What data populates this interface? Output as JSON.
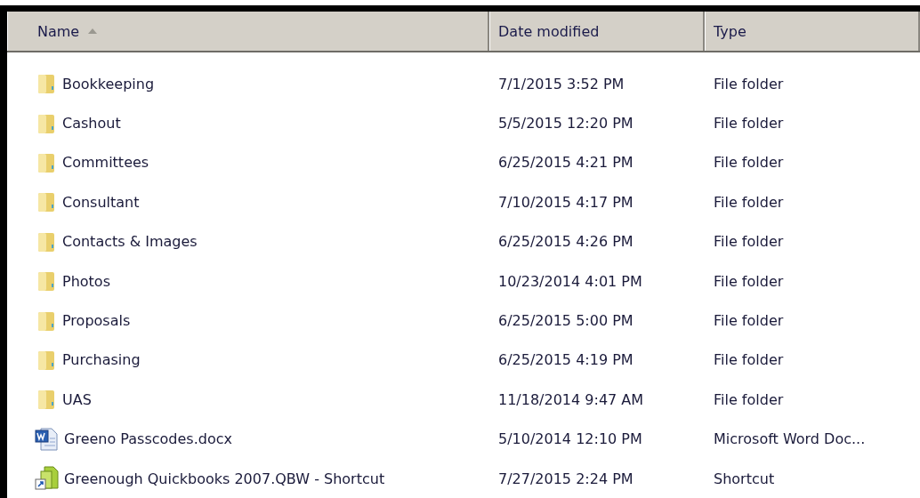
{
  "columns": [
    {
      "label": "Name",
      "sorted": true
    },
    {
      "label": "Date modified",
      "sorted": false
    },
    {
      "label": "Type",
      "sorted": false
    }
  ],
  "rows": [
    {
      "kind": "folder",
      "name": "Bookkeeping",
      "date": "7/1/2015 3:52 PM",
      "type": "File folder"
    },
    {
      "kind": "folder",
      "name": "Cashout",
      "date": "5/5/2015 12:20 PM",
      "type": "File folder"
    },
    {
      "kind": "folder",
      "name": "Committees",
      "date": "6/25/2015 4:21 PM",
      "type": "File folder"
    },
    {
      "kind": "folder",
      "name": "Consultant",
      "date": "7/10/2015 4:17 PM",
      "type": "File folder"
    },
    {
      "kind": "folder",
      "name": "Contacts & Images",
      "date": "6/25/2015 4:26 PM",
      "type": "File folder"
    },
    {
      "kind": "folder",
      "name": "Photos",
      "date": "10/23/2014 4:01 PM",
      "type": "File folder"
    },
    {
      "kind": "folder",
      "name": "Proposals",
      "date": "6/25/2015 5:00 PM",
      "type": "File folder"
    },
    {
      "kind": "folder",
      "name": "Purchasing",
      "date": "6/25/2015 4:19 PM",
      "type": "File folder"
    },
    {
      "kind": "folder",
      "name": "UAS",
      "date": "11/18/2014 9:47 AM",
      "type": "File folder"
    },
    {
      "kind": "word",
      "name": "Greeno Passcodes.docx",
      "date": "5/10/2014 12:10 PM",
      "type": "Microsoft Word Doc..."
    },
    {
      "kind": "shortcut",
      "name": "Greenough Quickbooks 2007.QBW - Shortcut",
      "date": "7/27/2015 2:24 PM",
      "type": "Shortcut"
    }
  ]
}
